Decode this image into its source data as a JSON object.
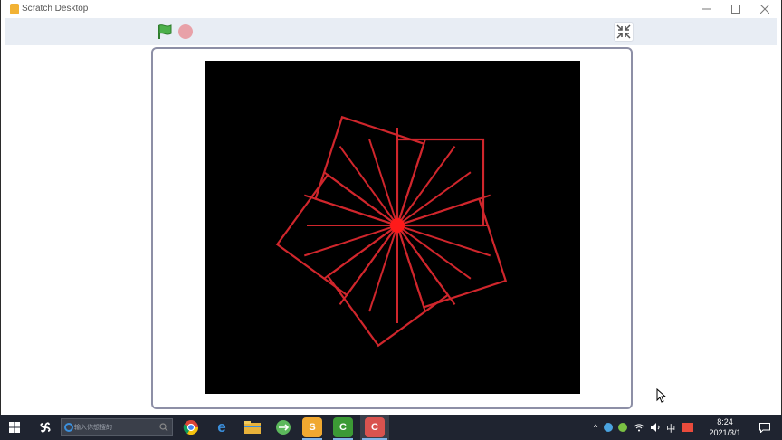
{
  "window": {
    "title": "Scratch Desktop",
    "minimize_icon": "minimize-icon",
    "maximize_icon": "maximize-icon",
    "close_icon": "close-icon"
  },
  "toolbar": {
    "green_flag_icon": "green-flag-icon",
    "stop_icon": "stop-sign-icon",
    "unfullscreen_icon": "exit-fullscreen-icon"
  },
  "stage": {
    "background": "#000000",
    "pen_color": "#d0262c",
    "center_dot_color": "#ff1a1a",
    "square_count": 5,
    "square_rotation_step_deg": 24,
    "spokes_count": 20
  },
  "taskbar": {
    "search_placeholder": "输入你想搜的",
    "apps": [
      "start-icon",
      "search-icon",
      "chrome-icon",
      "edge-icon",
      "file-explorer-icon",
      "green-app-icon",
      "scratch-icon",
      "camtasia-icon",
      "camtasia-recorder-icon"
    ],
    "ime": "中",
    "time": "8:24",
    "date": "2021/3/1"
  },
  "colors": {
    "flag": "#3fa33d",
    "stop": "#e8a1a8",
    "taskbar": "#1f2430",
    "stage_border": "#8d8fa6"
  }
}
